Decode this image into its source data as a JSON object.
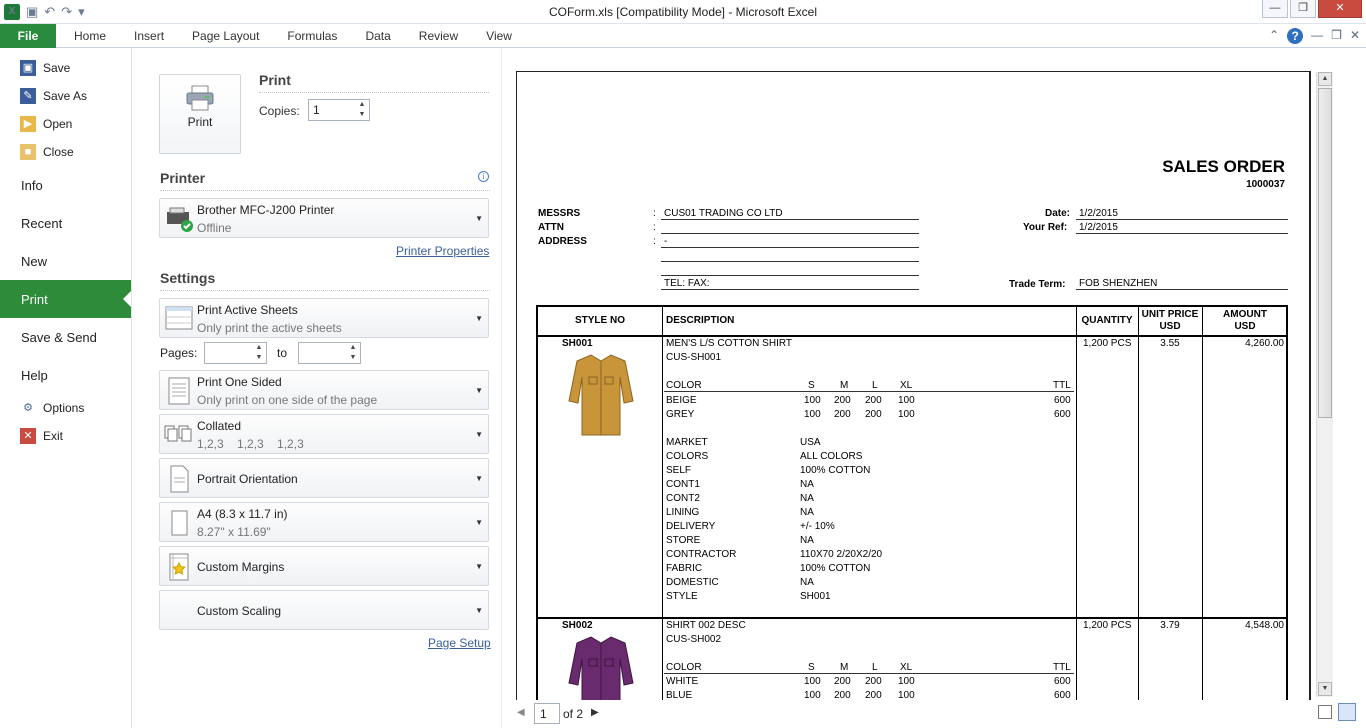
{
  "window": {
    "title": "COForm.xls  [Compatibility Mode]  -  Microsoft Excel"
  },
  "ribbon": {
    "file": "File",
    "tabs": [
      "Home",
      "Insert",
      "Page Layout",
      "Formulas",
      "Data",
      "Review",
      "View"
    ]
  },
  "backstage": {
    "save": "Save",
    "save_as": "Save As",
    "open": "Open",
    "close": "Close",
    "info": "Info",
    "recent": "Recent",
    "new": "New",
    "print": "Print",
    "save_send": "Save & Send",
    "help": "Help",
    "options": "Options",
    "exit": "Exit"
  },
  "print_panel": {
    "heading": "Print",
    "button": "Print",
    "copies_label": "Copies:",
    "copies_value": "1",
    "printer_heading": "Printer",
    "printer_name": "Brother MFC-J200 Printer",
    "printer_status": "Offline",
    "printer_properties": "Printer Properties",
    "settings_heading": "Settings",
    "sheets_title": "Print Active Sheets",
    "sheets_sub": "Only print the active sheets",
    "pages_label": "Pages:",
    "to_label": "to",
    "sided_title": "Print One Sided",
    "sided_sub": "Only print on one side of the page",
    "collated_title": "Collated",
    "collated_sub": "1,2,3    1,2,3    1,2,3",
    "orientation": "Portrait Orientation",
    "paper_title": "A4 (8.3 x 11.7 in)",
    "paper_sub": "8.27\" x 11.69\"",
    "margins": "Custom Margins",
    "scaling": "Custom Scaling",
    "page_setup": "Page Setup"
  },
  "sheet": {
    "title": "SALES ORDER",
    "number": "1000037",
    "messrs_label": "MESSRS",
    "attn_label": "ATTN",
    "address_label": "ADDRESS",
    "colon": ":",
    "messrs": "CUS01 TRADING CO LTD",
    "address": "-",
    "tel": "TEL:   FAX:",
    "date_label": "Date:",
    "date": "1/2/2015",
    "ref_label": "Your Ref:",
    "ref": "1/2/2015",
    "trade_label": "Trade Term:",
    "trade": "FOB SHENZHEN",
    "headers": {
      "style": "STYLE NO",
      "desc": "DESCRIPTION",
      "qty": "QUANTITY",
      "unit1": "UNIT PRICE",
      "unit2": "USD",
      "amt1": "AMOUNT",
      "amt2": "USD"
    },
    "size_headers": [
      "COLOR",
      "S",
      "M",
      "L",
      "XL",
      "TTL"
    ],
    "items": [
      {
        "style": "SH001",
        "name": "MEN'S L/S COTTON SHIRT",
        "code": "CUS-SH001",
        "qty": "1,200 PCS",
        "price": "3.55",
        "amount": "4,260.00",
        "colors": [
          {
            "c": "BEIGE",
            "s": "100",
            "m": "200",
            "l": "200",
            "xl": "100",
            "ttl": "600"
          },
          {
            "c": "GREY",
            "s": "100",
            "m": "200",
            "l": "200",
            "xl": "100",
            "ttl": "600"
          }
        ],
        "attrs": [
          [
            "MARKET",
            "USA"
          ],
          [
            "COLORS",
            "ALL COLORS"
          ],
          [
            "SELF",
            "100% COTTON"
          ],
          [
            "CONT1",
            "NA"
          ],
          [
            "CONT2",
            "NA"
          ],
          [
            "LINING",
            "NA"
          ],
          [
            "DELIVERY",
            "+/- 10%"
          ],
          [
            "STORE",
            "NA"
          ],
          [
            "CONTRACTOR",
            "110X70 2/20X2/20"
          ],
          [
            "FABRIC",
            "100% COTTON"
          ],
          [
            "DOMESTIC",
            "NA"
          ],
          [
            "STYLE",
            "SH001"
          ]
        ],
        "shirt_color": "#c9953a"
      },
      {
        "style": "SH002",
        "name": "SHIRT 002 DESC",
        "code": "CUS-SH002",
        "qty": "1,200 PCS",
        "price": "3.79",
        "amount": "4,548.00",
        "colors": [
          {
            "c": "WHITE",
            "s": "100",
            "m": "200",
            "l": "200",
            "xl": "100",
            "ttl": "600"
          },
          {
            "c": "BLUE",
            "s": "100",
            "m": "200",
            "l": "200",
            "xl": "100",
            "ttl": "600"
          }
        ],
        "shirt_color": "#6a2b6e"
      }
    ]
  },
  "nav": {
    "page": "1",
    "of": "of 2"
  },
  "colors": {
    "accent": "#2d8b3a",
    "link": "#3a5f99"
  }
}
